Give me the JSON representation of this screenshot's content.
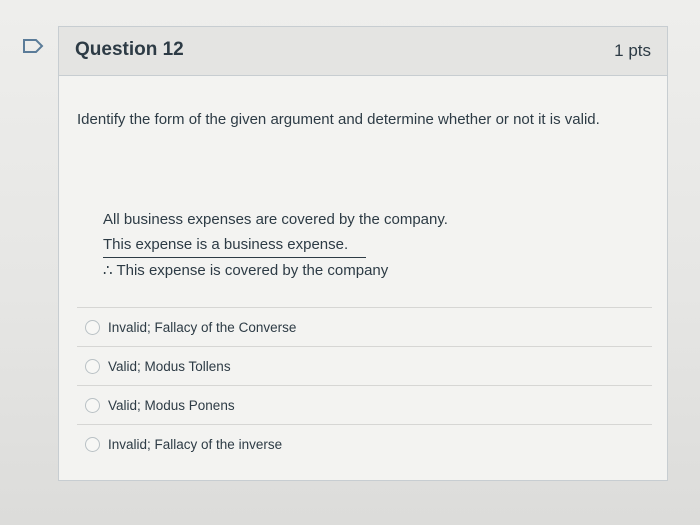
{
  "question": {
    "title": "Question 12",
    "points": "1 pts",
    "prompt": "Identify the form of the given argument and determine whether or not it is valid.",
    "argument": {
      "premise1": "All business expenses are covered by the company.",
      "premise2": "This expense is a business expense.",
      "conclusion": "∴ This expense is covered by the company"
    },
    "answers": [
      {
        "label": "Invalid; Fallacy of the Converse"
      },
      {
        "label": "Valid; Modus Tollens"
      },
      {
        "label": "Valid; Modus Ponens"
      },
      {
        "label": "Invalid; Fallacy of the inverse"
      }
    ]
  },
  "colors": {
    "text": "#2d3b45",
    "border": "#c7cdd1",
    "flag": "#5b7c99"
  },
  "icons": {
    "flag": "flag-icon",
    "radio": "radio-icon"
  }
}
